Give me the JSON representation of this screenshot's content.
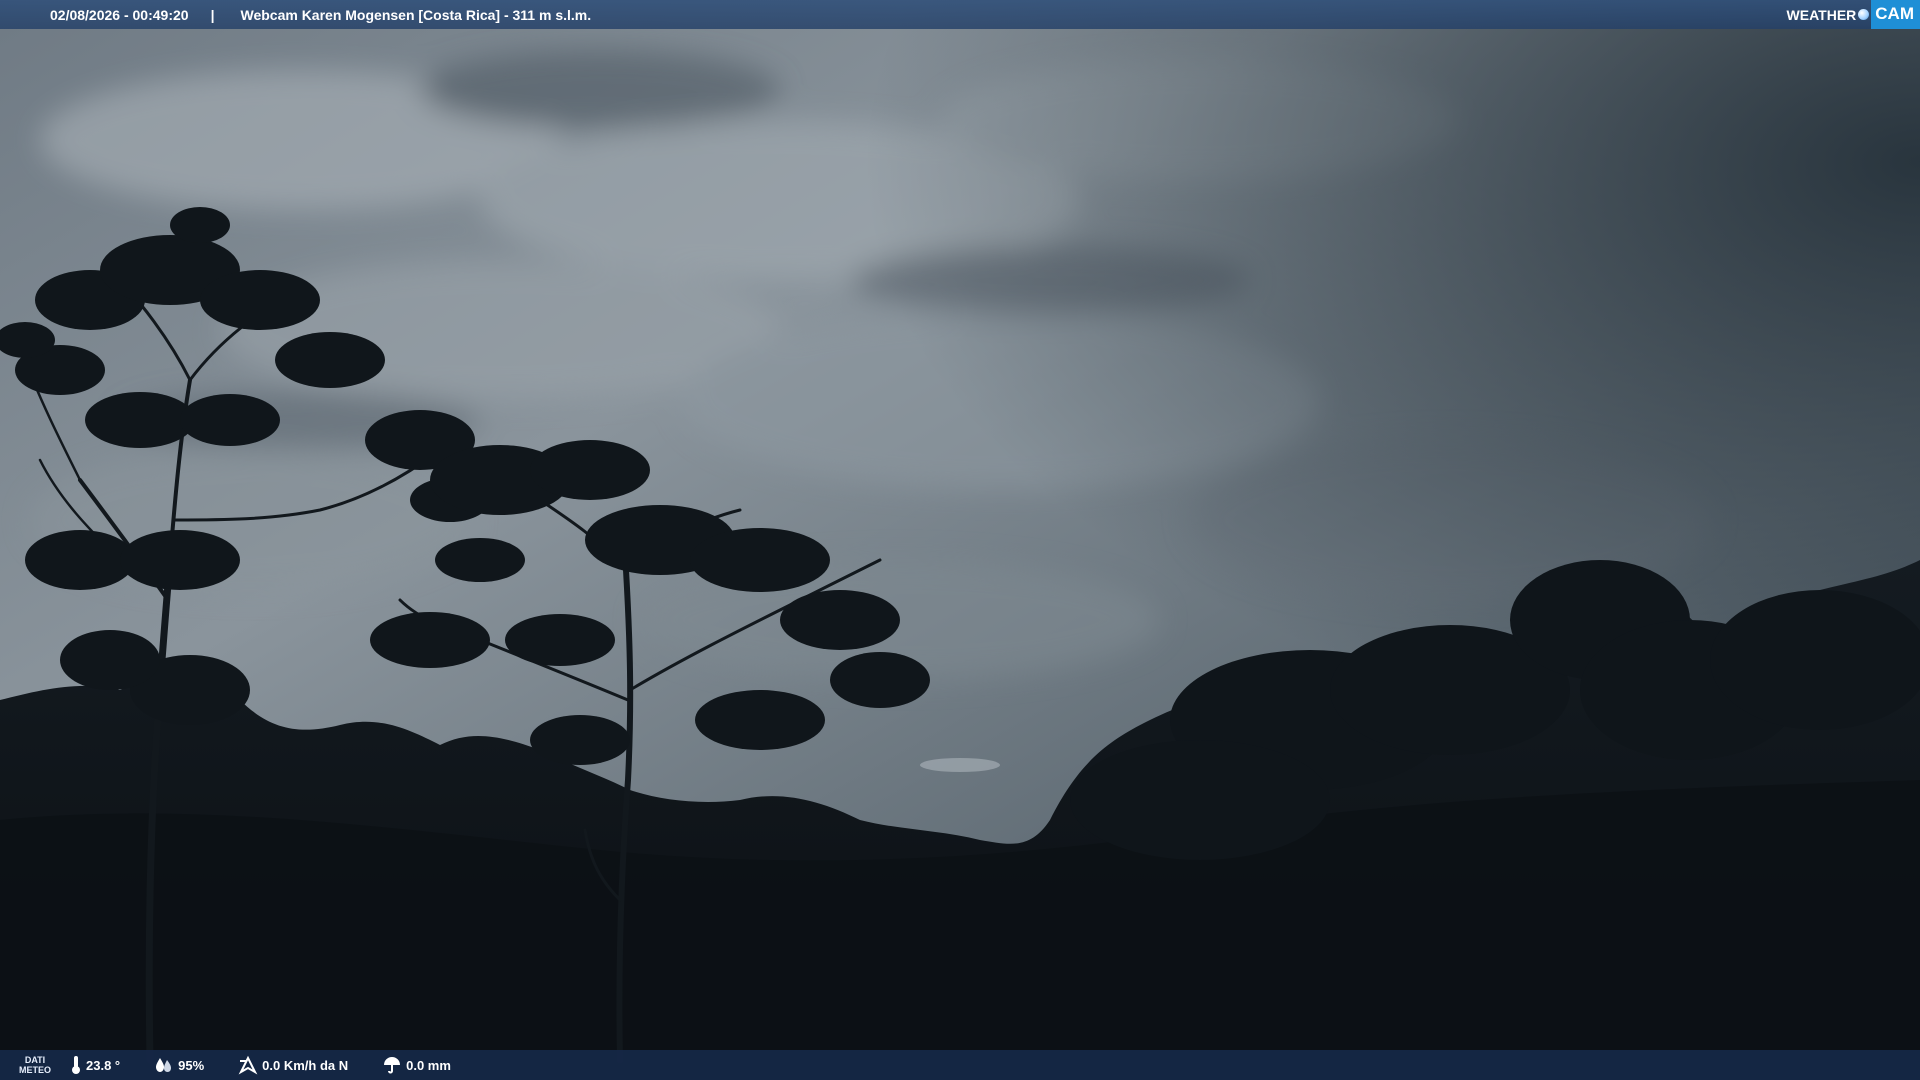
{
  "header": {
    "datetime": "02/08/2026 - 00:49:20",
    "separator": "|",
    "title": "Webcam Karen Mogensen [Costa Rica]  - 311 m s.l.m."
  },
  "logo": {
    "word_weather": "WEATHER",
    "word_cam": "CAM",
    "brand_color": "#1f8fd6"
  },
  "meteo": {
    "label_line1": "DATI",
    "label_line2": "METEO",
    "temperature": "23.8 °",
    "temperature_icon": "thermometer-icon",
    "humidity": "95%",
    "humidity_icon": "humidity-drop-icon",
    "wind": "0.0 Km/h da N",
    "wind_icon": "wind-direction-icon",
    "rain": "0.0 mm",
    "rain_icon": "rain-umbrella-icon"
  },
  "scene": {
    "description_colors": {
      "sky_light": "#8b96a0",
      "sky_dark": "#2c3943",
      "foliage": "#0d1217"
    }
  }
}
